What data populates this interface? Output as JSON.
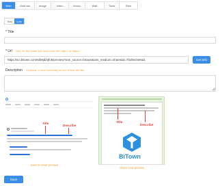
{
  "tabs": [
    "Web",
    "Gold wiz",
    "Image",
    "Video",
    "Music",
    "Wall",
    "Tools",
    "Files"
  ],
  "sub_toggle": [
    "Text",
    "Link"
  ],
  "title_field": {
    "label": "* Title",
    "value": ""
  },
  "url_field": {
    "label": "* Url",
    "hint": "URL for the share link must start with http:// or https://",
    "value": "https://sci.bitown.com/6/b8jd2qfo5/preview?utm_source=bitown&utm_medium=share&id=7f2d9c04e5a1",
    "button": "Get Info"
  },
  "description_field": {
    "label": "Description",
    "hint": "Optional, a short summary shown below the title",
    "value": ""
  },
  "preview_left": {
    "caption": "Search result preview",
    "title_marker": "Title",
    "describe_marker": "Describe"
  },
  "preview_right": {
    "caption": "Share card preview",
    "title_marker": "Title",
    "describe_marker": "Describe",
    "brand": "BiTown"
  },
  "submit_button": "Save",
  "colors": {
    "accent": "#3a8ee6",
    "hint": "#f0a33a",
    "marker": "#e53935",
    "brand": "#2f8fdf"
  }
}
